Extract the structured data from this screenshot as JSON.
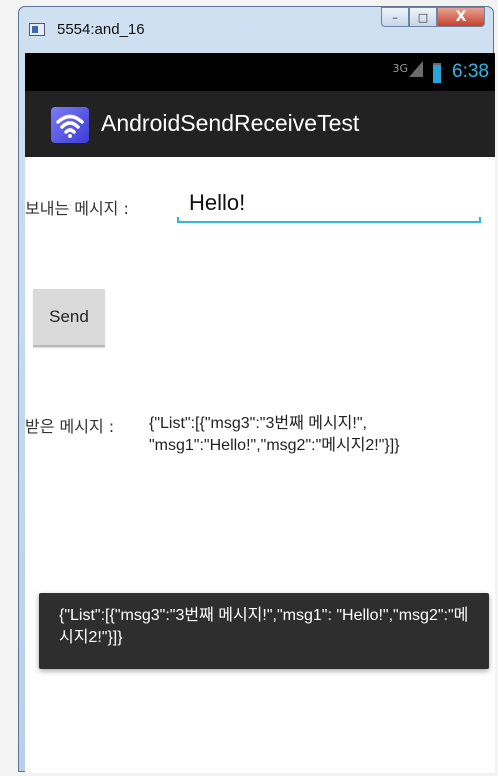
{
  "window": {
    "title": "5554:and_16",
    "minimize": "–",
    "maximize": "□",
    "close": "X"
  },
  "status_bar": {
    "network": "3G",
    "time": "6:38"
  },
  "action_bar": {
    "title": "AndroidSendReceiveTest",
    "icon": "wifi-icon"
  },
  "form": {
    "message_label": "보내는 메시지 :",
    "message_value": "Hello!",
    "send_label": "Send"
  },
  "received": {
    "label": "받은 메시지 :",
    "text": "{\"List\":[{\"msg3\":\"3번째 메시지!\", \"msg1\":\"Hello!\",\"msg2\":\"메시지2!\"}]}"
  },
  "toast": {
    "text": "{\"List\":[{\"msg3\":\"3번째 메시지!\",\"msg1\": \"Hello!\",\"msg2\":\"메시지2!\"}]}"
  },
  "colors": {
    "accent": "#33b5e5",
    "action_bar": "#222222",
    "toast": "#2e2e2e"
  }
}
